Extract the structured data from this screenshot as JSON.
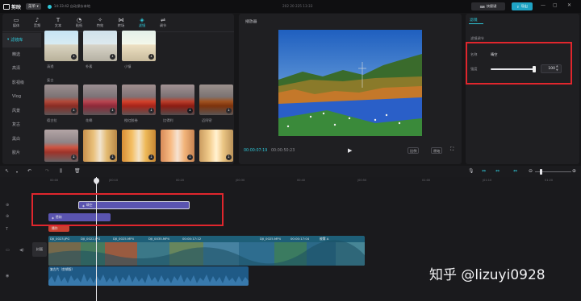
{
  "app": {
    "name": "剪映",
    "menu_label": "菜单",
    "project_status": "14:33:42 自动保存本地",
    "project_name": "202 20 225 13:33"
  },
  "header": {
    "shortcut_label": "快捷键",
    "export_label": "导出"
  },
  "toolbar": {
    "tabs": [
      {
        "label": "媒体",
        "icon": "media-icon"
      },
      {
        "label": "音频",
        "icon": "audio-icon"
      },
      {
        "label": "文本",
        "icon": "text-icon"
      },
      {
        "label": "贴纸",
        "icon": "sticker-icon"
      },
      {
        "label": "特效",
        "icon": "effects-icon"
      },
      {
        "label": "转场",
        "icon": "transition-icon"
      },
      {
        "label": "滤镜",
        "icon": "filter-icon"
      },
      {
        "label": "调节",
        "icon": "adjust-icon"
      }
    ],
    "active_tab": "滤镜"
  },
  "sidebar": {
    "items": [
      "滤镜库",
      "精选",
      "高清",
      "影视级",
      "Vlog",
      "风景",
      "复古",
      "黑白",
      "胶片"
    ],
    "active": "滤镜库"
  },
  "filters": {
    "row1": [
      "清透",
      "朴素",
      "小镇"
    ],
    "group_label": "复古",
    "row2": [
      "德古拉",
      "花椰",
      "橙红胶卷",
      "比得利",
      "迈阿密"
    ],
    "row3": [
      "",
      "",
      "",
      "",
      ""
    ]
  },
  "player": {
    "title": "播放器",
    "current_time": "00:00:07:19",
    "total_time": "00:00:50:23",
    "ratio_label": "比例",
    "original_label": "原始"
  },
  "properties": {
    "tab_label": "滤镜",
    "section_title": "滤镜调节",
    "name_label": "名称",
    "name_value": "晴空",
    "strength_label": "强度",
    "strength_value": "100",
    "strength_fraction": 1.0
  },
  "timeline": {
    "ruler_ticks": [
      "00:00",
      "|00:10",
      "00:20",
      "|00:30",
      "00:40",
      "|00:50",
      "01:00",
      "|01:10",
      "01:20"
    ],
    "filter_clips": [
      "晴空",
      "德纳"
    ],
    "red_clip_label": "播作",
    "video_labels": [
      "DJI_0023.JPG",
      "DJI_0022.JPG",
      "DJI_0025.MP4",
      "DJI_0035.MP4",
      "00:00:17:12",
      "DJI_0025.MP4",
      "00:00:17:04",
      "被雾 A"
    ],
    "cover_label": "封面",
    "audio_label": "复古片（剪辑版）"
  },
  "watermark": "知乎 @lizuyi0928"
}
